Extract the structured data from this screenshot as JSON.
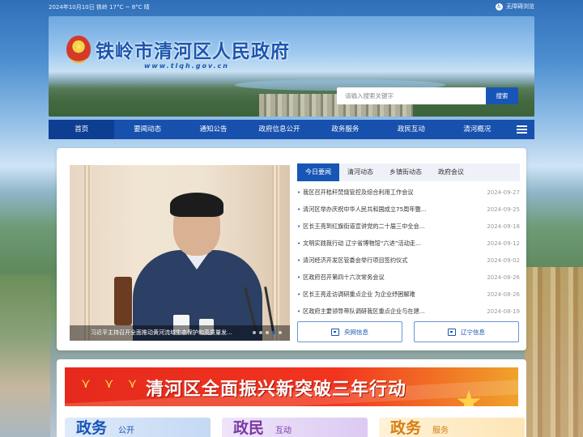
{
  "topbar": {
    "date_weather": "2024年10月10日  铁岭  17°C ~ 8°C  晴",
    "accessibility": "无障碍浏览"
  },
  "header": {
    "title": "铁岭市清河区人民政府",
    "domain": "www.tlqh.gov.cn",
    "search_placeholder": "请输入搜索关键字",
    "search_button": "搜索"
  },
  "nav": {
    "items": [
      {
        "label": "首页"
      },
      {
        "label": "要闻动态"
      },
      {
        "label": "通知公告"
      },
      {
        "label": "政府信息公开"
      },
      {
        "label": "政务服务"
      },
      {
        "label": "政民互动"
      },
      {
        "label": "清河概况"
      }
    ]
  },
  "news": {
    "photo_caption": "习近平主持召开全面推动黄河流域生态保护和高质量发...",
    "tabs": [
      {
        "label": "今日要闻"
      },
      {
        "label": "清河动态"
      },
      {
        "label": "乡镇街动态"
      },
      {
        "label": "政府会议"
      }
    ],
    "items": [
      {
        "title": "我区召开秸秆焚烧管控及综合利用工作会议",
        "date": "2024-09-27"
      },
      {
        "title": "清河区举办庆祝中华人民共和国成立75周年暨...",
        "date": "2024-09-25"
      },
      {
        "title": "区长王亮到红旗街道宣讲党的二十届三中全会...",
        "date": "2024-09-18"
      },
      {
        "title": "文明实践我行动 辽宁省博物馆“六进”活动走...",
        "date": "2024-09-12"
      },
      {
        "title": "清河经济开发区管委会举行项目签约仪式",
        "date": "2024-09-02"
      },
      {
        "title": "区政府召开第四十六次常务会议",
        "date": "2024-08-26"
      },
      {
        "title": "区长王亮走访调研重点企业 为企业纾困解难",
        "date": "2024-08-26"
      },
      {
        "title": "区政府主要领导带队调研我区重点企业与在建...",
        "date": "2024-08-19"
      }
    ],
    "link_central": "央网信息",
    "link_liaoning": "辽宁信息"
  },
  "promo": {
    "banner_text": "清河区全面振兴新突破三年行动",
    "cards": [
      {
        "big": "政务",
        "small": "公开"
      },
      {
        "big": "政民",
        "small": "互动"
      },
      {
        "big": "政务",
        "small": "服务"
      }
    ]
  },
  "colors": {
    "brand_blue": "#1756b6",
    "nav_active": "#0e3e92",
    "promo_red": "#e52a1d"
  }
}
